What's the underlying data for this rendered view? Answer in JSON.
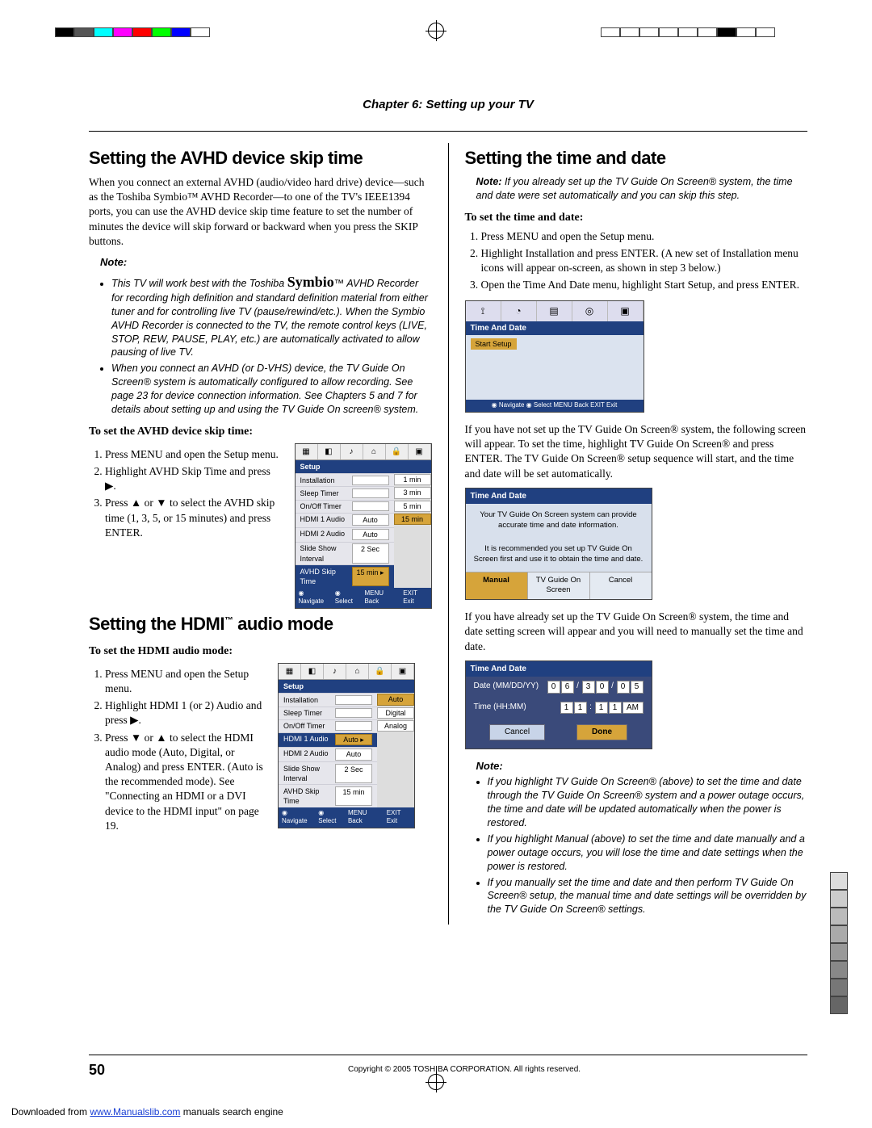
{
  "chapter_header": "Chapter 6: Setting up your TV",
  "left": {
    "h_avhd": "Setting the AVHD device skip time",
    "avhd_intro": "When you connect an external AVHD (audio/video hard drive) device—such as the Toshiba Symbio™ AVHD Recorder—to one of the TV's IEEE1394 ports, you can use the AVHD device skip time feature to set the number of minutes the device will skip forward or backward when you press the SKIP buttons.",
    "note_label": "Note:",
    "avhd_notes": [
      "This TV will work best with the Toshiba Symbio™ AVHD Recorder for recording high definition and standard definition material from either tuner and for controlling live TV (pause/rewind/etc.). When the Symbio AVHD Recorder is connected to the TV, the remote control keys (LIVE, STOP, REW, PAUSE, PLAY, etc.) are automatically activated to allow pausing of live TV.",
      "When you connect an AVHD (or D-VHS) device, the TV Guide On Screen® system is automatically configured to allow recording. See page 23 for device connection information. See Chapters 5 and 7 for details about setting up and using the TV Guide On screen® system."
    ],
    "avhd_proc_head": "To set the AVHD device skip time:",
    "avhd_steps": [
      "Press MENU and open the Setup menu.",
      "Highlight AVHD Skip Time and press ▶.",
      "Press ▲ or ▼ to select the AVHD skip time (1, 3, 5, or 15 minutes) and press ENTER."
    ],
    "avhd_menu": {
      "title": "Setup",
      "rows": [
        {
          "label": "Installation",
          "val": ""
        },
        {
          "label": "Sleep Timer",
          "val": ""
        },
        {
          "label": "On/Off Timer",
          "val": ""
        },
        {
          "label": "HDMI 1 Audio",
          "val": "Auto"
        },
        {
          "label": "HDMI 2 Audio",
          "val": "Auto"
        },
        {
          "label": "Slide Show Interval",
          "val": "2 Sec"
        },
        {
          "label": "AVHD Skip Time",
          "val": "15 min ▸",
          "sel": true
        }
      ],
      "opts": [
        "1 min",
        "3 min",
        "5 min",
        "15 min"
      ],
      "opt_sel": 3,
      "foot": [
        "◉ Navigate",
        "◉ Select",
        "MENU Back",
        "EXIT Exit"
      ]
    },
    "h_hdmi": "Setting the HDMI™ audio mode",
    "hdmi_proc_head": "To set the HDMI audio mode:",
    "hdmi_steps": [
      "Press MENU and open the Setup menu.",
      "Highlight HDMI 1 (or 2) Audio and press ▶.",
      "Press ▼ or ▲ to select the HDMI audio mode (Auto, Digital, or Analog) and press ENTER. (Auto is the recommended mode). See \"Connecting an HDMI or a DVI device to the HDMI input\" on page 19."
    ],
    "hdmi_menu": {
      "title": "Setup",
      "rows": [
        {
          "label": "Installation",
          "val": ""
        },
        {
          "label": "Sleep Timer",
          "val": ""
        },
        {
          "label": "On/Off Timer",
          "val": ""
        },
        {
          "label": "HDMI 1 Audio",
          "val": "Auto ▸",
          "sel": true
        },
        {
          "label": "HDMI 2 Audio",
          "val": "Auto"
        },
        {
          "label": "Slide Show Interval",
          "val": "2 Sec"
        },
        {
          "label": "AVHD Skip Time",
          "val": "15 min"
        }
      ],
      "opts": [
        "Auto",
        "Digital",
        "Analog"
      ],
      "opt_sel": 0,
      "foot": [
        "◉ Navigate",
        "◉ Select",
        "MENU Back",
        "EXIT Exit"
      ]
    }
  },
  "right": {
    "h_time": "Setting the time and date",
    "time_note": "If you already set up the TV Guide On Screen® system, the time and date were set automatically and you can skip this step.",
    "time_proc_head": "To set the time and date:",
    "time_steps": [
      "Press MENU and open the Setup menu.",
      "Highlight Installation and press ENTER. (A new set of Installation menu icons will appear on-screen, as shown in step 3 below.)",
      "Open the Time And Date menu, highlight Start Setup, and press ENTER."
    ],
    "td_menu": {
      "title": "Time And Date",
      "sub": "Start Setup",
      "foot": "◉ Navigate  ◉ Select  MENU Back  EXIT Exit"
    },
    "para_after1": "If you have not set up the TV Guide On Screen® system, the following screen will appear. To set the time, highlight TV Guide On Screen® and press ENTER. The TV Guide On Screen® setup sequence will start, and the time and date will be set automatically.",
    "td_dialog": {
      "hdr": "Time And Date",
      "msg1": "Your TV Guide On Screen system can provide accurate time and date information.",
      "msg2": "It is recommended you set up TV Guide On Screen first and use it to obtain the time and date.",
      "btns": [
        "Manual",
        "TV Guide On Screen",
        "Cancel"
      ],
      "btn_sel": 0
    },
    "para_after2": "If you have already set up the TV Guide On Screen® system, the time and date setting screen will appear and you will need to manually set the time and date.",
    "td_form": {
      "hdr": "Time And Date",
      "date_label": "Date (MM/DD/YY)",
      "date_cells": [
        "0",
        "6",
        "/",
        "3",
        "0",
        "/",
        "0",
        "5"
      ],
      "time_label": "Time (HH:MM)",
      "time_cells": [
        "1",
        "1",
        ":",
        "1",
        "1",
        "AM"
      ],
      "btns": [
        "Cancel",
        "Done"
      ],
      "btn_sel": 1
    },
    "end_notes": [
      "If you highlight TV Guide On Screen® (above) to set the time and date through the TV Guide On Screen® system and a power outage occurs, the time and date will be updated automatically when the power is restored.",
      "If you highlight Manual (above) to set the time and date manually and a power outage occurs, you will lose the time and date settings when the power is restored.",
      "If you manually set the time and date and then perform TV Guide On Screen® setup, the manual time and date settings will be overridden by the TV Guide On Screen® settings."
    ]
  },
  "footer": {
    "page": "50",
    "copyright": "Copyright © 2005 TOSHIBA CORPORATION. All rights reserved."
  },
  "download": {
    "prefix": "Downloaded from ",
    "link": "www.Manualslib.com",
    "suffix": " manuals search engine"
  }
}
